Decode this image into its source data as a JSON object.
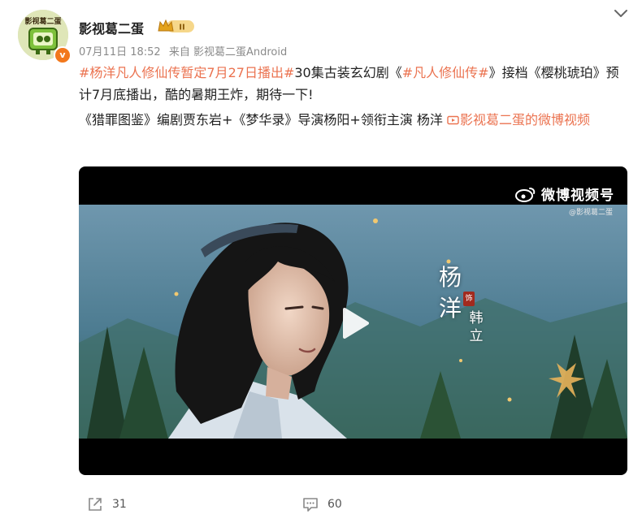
{
  "author": {
    "name": "影视葛二蛋",
    "avatar_text": "影视葛二蛋",
    "verified_mark": "v",
    "rank_badge": "II"
  },
  "meta": {
    "time": "07月11日 18:52",
    "source": "来自 影视葛二蛋Android"
  },
  "content": {
    "hashtag1": "#杨洋凡人修仙传暂定7月27日播出#",
    "text1": "30集古装玄幻剧《",
    "hashtag2": "#凡人修仙传#",
    "text2": "》接档《樱桃琥珀》预计7月底播出，酷的暑期王炸，期待一下!",
    "line2": "《猎罪图鉴》编剧贾东岩+《梦华录》导演杨阳+领衔主演 杨洋 ",
    "video_link": "影视葛二蛋的微博视频"
  },
  "video": {
    "watermark": "微博视频号",
    "watermark_sub": "@影视葛二蛋",
    "caption_name": "杨洋",
    "caption_seal": "饰",
    "caption_role": "韩立"
  },
  "actions": {
    "share_count": "31",
    "comment_count": "60"
  },
  "colors": {
    "link": "#eb7350",
    "meta": "#8a8a8a"
  }
}
